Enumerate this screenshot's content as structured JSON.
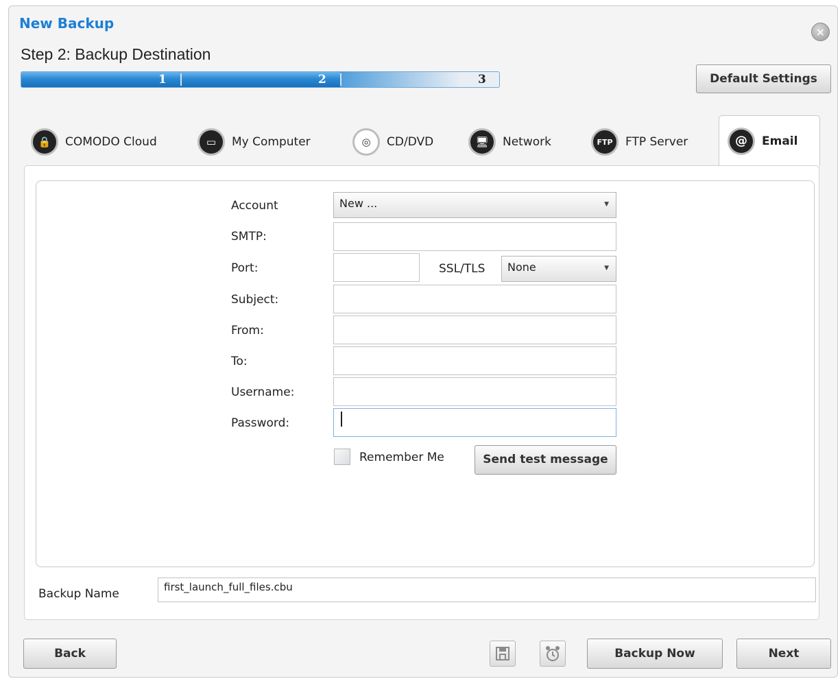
{
  "window": {
    "title": "New Backup",
    "step_title": "Step 2: Backup Destination",
    "close_glyph": "✕",
    "default_settings_label": "Default Settings"
  },
  "progress": {
    "steps": [
      "1",
      "2",
      "3"
    ],
    "current_step": 2,
    "fraction": 0.72
  },
  "tabs": [
    {
      "label": "COMODO Cloud",
      "icon": "cloud-lock-icon",
      "glyph": "🔒"
    },
    {
      "label": "My Computer",
      "icon": "monitor-icon",
      "glyph": "▭"
    },
    {
      "label": "CD/DVD",
      "icon": "disc-icon",
      "glyph": "◎"
    },
    {
      "label": "Network",
      "icon": "network-icon",
      "glyph": "🖥"
    },
    {
      "label": "FTP Server",
      "icon": "ftp-icon",
      "glyph": "FTP"
    },
    {
      "label": "Email",
      "icon": "at-sign-icon",
      "glyph": "@",
      "active": true
    }
  ],
  "form": {
    "account_label": "Account",
    "account_value": "New ...",
    "smtp_label": "SMTP:",
    "smtp_value": "",
    "port_label": "Port:",
    "port_value": "",
    "ssl_label": "SSL/TLS",
    "ssl_value": "None",
    "subject_label": "Subject:",
    "subject_value": "",
    "from_label": "From:",
    "from_value": "",
    "to_label": "To:",
    "to_value": "",
    "username_label": "Username:",
    "username_value": "",
    "password_label": "Password:",
    "password_value": "",
    "remember_label": "Remember Me",
    "remember_checked": false,
    "send_test_label": "Send test message"
  },
  "backup_name": {
    "label": "Backup Name",
    "value": "first_launch_full_files.cbu"
  },
  "footer": {
    "back_label": "Back",
    "save_icon": "floppy-disk-icon",
    "schedule_icon": "alarm-clock-icon",
    "backup_now_label": "Backup Now",
    "next_label": "Next"
  },
  "colors": {
    "accent": "#1c7fd6",
    "progress_fill": "#2a89d4"
  }
}
